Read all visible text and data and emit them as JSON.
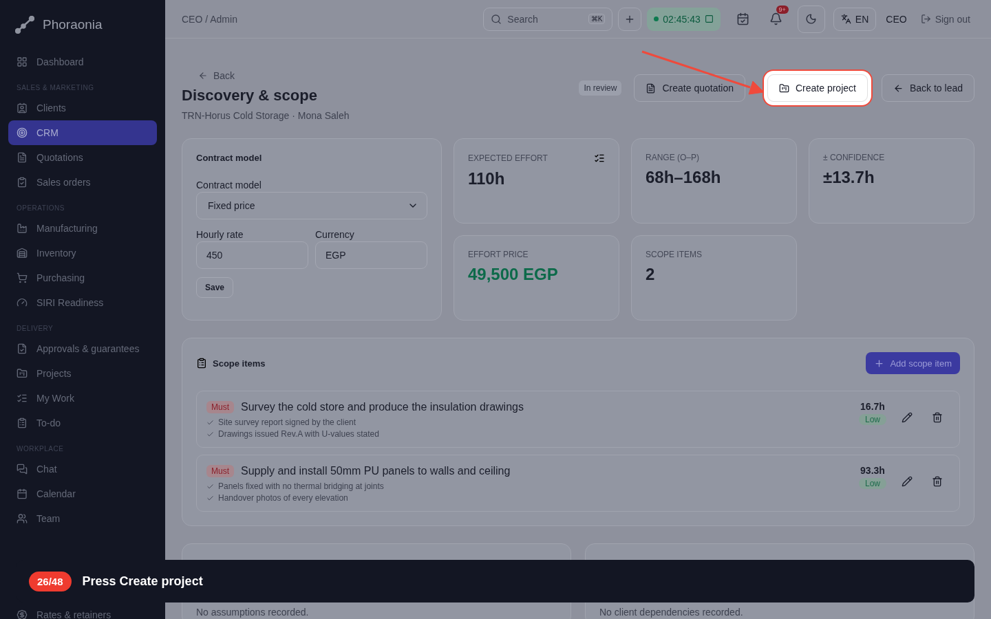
{
  "sidebar": {
    "brand": "Phoraonia",
    "sections": [
      {
        "items": [
          {
            "label": "Dashboard",
            "selected": false
          }
        ]
      },
      {
        "label": "SALES & MARKETING",
        "items": [
          {
            "label": "Clients",
            "selected": false
          },
          {
            "label": "CRM",
            "selected": true
          },
          {
            "label": "Quotations",
            "selected": false
          },
          {
            "label": "Sales orders",
            "selected": false
          }
        ]
      },
      {
        "label": "OPERATIONS",
        "items": [
          {
            "label": "Manufacturing",
            "selected": false
          },
          {
            "label": "Inventory",
            "selected": false
          },
          {
            "label": "Purchasing",
            "selected": false
          },
          {
            "label": "SIRI Readiness",
            "selected": false
          }
        ]
      },
      {
        "label": "DELIVERY",
        "items": [
          {
            "label": "Approvals & guarantees",
            "selected": false
          },
          {
            "label": "Projects",
            "selected": false
          },
          {
            "label": "My Work",
            "selected": false
          },
          {
            "label": "To-do",
            "selected": false
          }
        ]
      },
      {
        "label": "WORKPLACE",
        "items": [
          {
            "label": "Chat",
            "selected": false
          },
          {
            "label": "Calendar",
            "selected": false
          },
          {
            "label": "Team",
            "selected": false
          }
        ]
      }
    ],
    "footer_item": "Rates & retainers"
  },
  "topbar": {
    "breadcrumb": "CEO / Admin",
    "search": {
      "placeholder": "Search",
      "shortcut": "⌘K"
    },
    "timer": "02:45:43",
    "notification_badge": "9+",
    "language": "EN",
    "role": "CEO",
    "sign_out": "Sign out"
  },
  "header": {
    "back": "Back",
    "title": "Discovery & scope",
    "subtitle": "TRN-Horus Cold Storage · Mona Saleh",
    "status": "In review",
    "actions": [
      {
        "label": "Create quotation",
        "highlighted": false
      },
      {
        "label": "Create project",
        "highlighted": true
      },
      {
        "label": "Back to lead",
        "highlighted": false
      }
    ]
  },
  "contract": {
    "title": "Contract model",
    "model_label": "Contract model",
    "model_value": "Fixed price",
    "rate_label": "Hourly rate",
    "rate_value": "450",
    "currency_label": "Currency",
    "currency_value": "EGP",
    "save": "Save"
  },
  "stats": [
    {
      "label": "EXPECTED EFFORT",
      "value": "110h",
      "kind": "plain"
    },
    {
      "label": "RANGE (O–P)",
      "value": "68h–168h",
      "kind": "plain"
    },
    {
      "label": "± CONFIDENCE",
      "value": "±13.7h",
      "kind": "plain"
    },
    {
      "label": "EFFORT PRICE",
      "value": "49,500 EGP",
      "kind": "money"
    },
    {
      "label": "SCOPE ITEMS",
      "value": "2",
      "kind": "plain"
    }
  ],
  "scope": {
    "title": "Scope items",
    "add_button": "Add scope item",
    "items": [
      {
        "priority": "Must",
        "title": "Survey the cold store and produce the insulation drawings",
        "criteria": [
          "Site survey report signed by the client",
          "Drawings issued Rev.A with U-values stated"
        ],
        "hours": "16.7h",
        "risk": "Low"
      },
      {
        "priority": "Must",
        "title": "Supply and install 50mm PU panels to walls and ceiling",
        "criteria": [
          "Panels fixed with no thermal bridging at joints",
          "Handover photos of every elevation"
        ],
        "hours": "93.3h",
        "risk": "Low"
      }
    ]
  },
  "bottom_cards": [
    {
      "empty_text": "No assumptions recorded."
    },
    {
      "empty_text": "No client dependencies recorded."
    }
  ],
  "tour": {
    "step": "26/48",
    "text": "Press Create project"
  }
}
